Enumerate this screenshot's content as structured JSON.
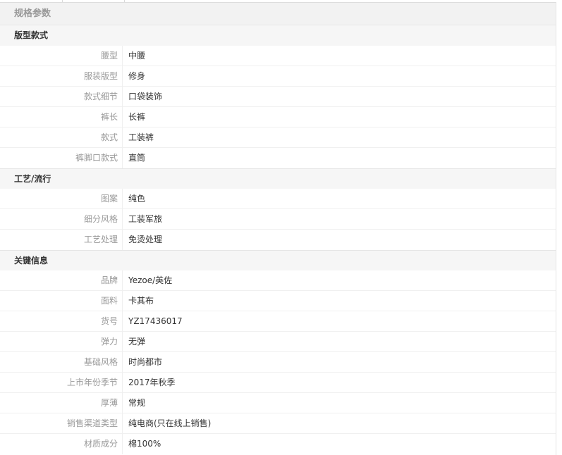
{
  "panel_title": "规格参数",
  "groups": [
    {
      "title": "版型款式",
      "rows": [
        {
          "label": "腰型",
          "value": "中腰"
        },
        {
          "label": "服装版型",
          "value": "修身"
        },
        {
          "label": "款式细节",
          "value": "口袋装饰"
        },
        {
          "label": "裤长",
          "value": "长裤"
        },
        {
          "label": "款式",
          "value": "工装裤"
        },
        {
          "label": "裤脚口款式",
          "value": "直筒"
        }
      ]
    },
    {
      "title": "工艺/流行",
      "rows": [
        {
          "label": "图案",
          "value": "纯色"
        },
        {
          "label": "细分风格",
          "value": "工装军旅"
        },
        {
          "label": "工艺处理",
          "value": "免烫处理"
        }
      ]
    },
    {
      "title": "关键信息",
      "rows": [
        {
          "label": "品牌",
          "value": "Yezoe/英佐"
        },
        {
          "label": "面料",
          "value": "卡其布"
        },
        {
          "label": "货号",
          "value": "YZ17436017"
        },
        {
          "label": "弹力",
          "value": "无弹"
        },
        {
          "label": "基础风格",
          "value": "时尚都市"
        },
        {
          "label": "上市年份季节",
          "value": "2017年秋季"
        },
        {
          "label": "厚薄",
          "value": "常规"
        },
        {
          "label": "销售渠道类型",
          "value": "纯电商(只在线上销售)"
        },
        {
          "label": "材质成分",
          "value": "棉100%"
        }
      ]
    }
  ]
}
